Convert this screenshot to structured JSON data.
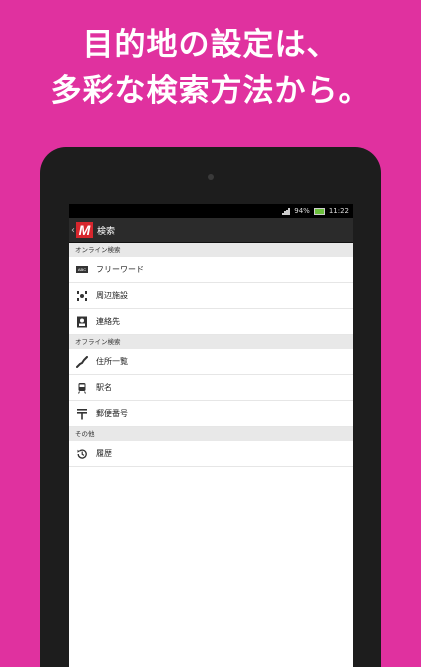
{
  "headline": {
    "line1": "目的地の設定は、",
    "line2": "多彩な検索方法から。"
  },
  "statusbar": {
    "battery_percent": "94%",
    "time": "11:22"
  },
  "actionbar": {
    "logo_letter": "M",
    "title": "検索"
  },
  "sections": [
    {
      "header": "オンライン検索",
      "items": [
        {
          "label": "フリーワード",
          "icon": "abc-keyboard-icon"
        },
        {
          "label": "周辺施設",
          "icon": "nearby-facilities-icon"
        },
        {
          "label": "連絡先",
          "icon": "contacts-icon"
        }
      ]
    },
    {
      "header": "オフライン検索",
      "items": [
        {
          "label": "住所一覧",
          "icon": "japan-map-icon"
        },
        {
          "label": "駅名",
          "icon": "train-icon"
        },
        {
          "label": "郵便番号",
          "icon": "postal-mark-icon"
        }
      ]
    },
    {
      "header": "その他",
      "items": [
        {
          "label": "履歴",
          "icon": "history-icon"
        }
      ]
    }
  ],
  "abc_icon_text": "ABC",
  "colors": {
    "background": "#e0319f",
    "logo": "#d7262d",
    "battery": "#6bbf3c"
  }
}
